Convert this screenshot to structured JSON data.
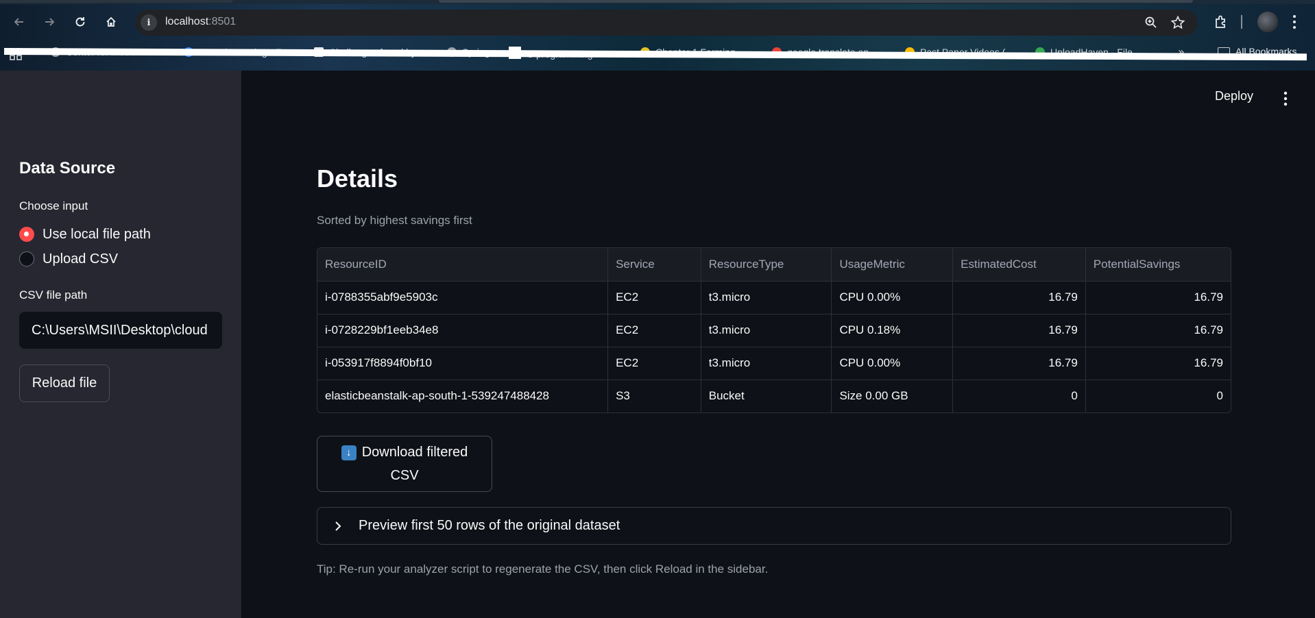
{
  "browser": {
    "url_host": "localhost",
    "url_port": ":8501",
    "bookmarks": [
      {
        "label": "Center for Modern...",
        "color": "#9aa0a6"
      },
      {
        "label": "Launch Meeting - Z...",
        "color": "#2d8cff"
      },
      {
        "label": "Challenges faced by...",
        "color": "#e8eaed"
      },
      {
        "label": "Spring",
        "color": "#9aa0a6"
      },
      {
        "label": "C programming",
        "color": "#ffffff"
      },
      {
        "label": "Chapter 1 Forming...",
        "color": "#e6c229"
      },
      {
        "label": "google translate en...",
        "color": "#ea4335"
      },
      {
        "label": "Past Paper Videos (...",
        "color": "#fbbc04"
      },
      {
        "label": "UploadHaven - File...",
        "color": "#34a853"
      }
    ],
    "more": "»",
    "all_bookmarks": "All Bookmarks"
  },
  "sidebar": {
    "title": "Data Source",
    "choose_label": "Choose input",
    "options": [
      {
        "label": "Use local file path",
        "selected": true
      },
      {
        "label": "Upload CSV",
        "selected": false
      }
    ],
    "path_label": "CSV file path",
    "path_value": "C:\\Users\\MSII\\Desktop\\cloud",
    "reload_label": "Reload file"
  },
  "header": {
    "deploy_label": "Deploy"
  },
  "main": {
    "title": "Details",
    "caption": "Sorted by highest savings first",
    "table": {
      "columns": [
        "ResourceID",
        "Service",
        "ResourceType",
        "UsageMetric",
        "EstimatedCost",
        "PotentialSavings"
      ],
      "rows": [
        [
          "i-0788355abf9e5903c",
          "EC2",
          "t3.micro",
          "CPU 0.00%",
          "16.79",
          "16.79"
        ],
        [
          "i-0728229bf1eeb34e8",
          "EC2",
          "t3.micro",
          "CPU 0.18%",
          "16.79",
          "16.79"
        ],
        [
          "i-053917f8894f0bf10",
          "EC2",
          "t3.micro",
          "CPU 0.00%",
          "16.79",
          "16.79"
        ],
        [
          "elasticbeanstalk-ap-south-1-539247488428",
          "S3",
          "Bucket",
          "Size 0.00 GB",
          "0",
          "0"
        ]
      ]
    },
    "download_label": "Download filtered CSV",
    "expander_label": "Preview first 50 rows of the original dataset",
    "tip": "Tip: Re-run your analyzer script to regenerate the CSV, then click Reload in the sidebar."
  },
  "colors": {
    "accent": "#ff4b4b",
    "sidebar_bg": "#262730",
    "main_bg": "#0e1117"
  }
}
